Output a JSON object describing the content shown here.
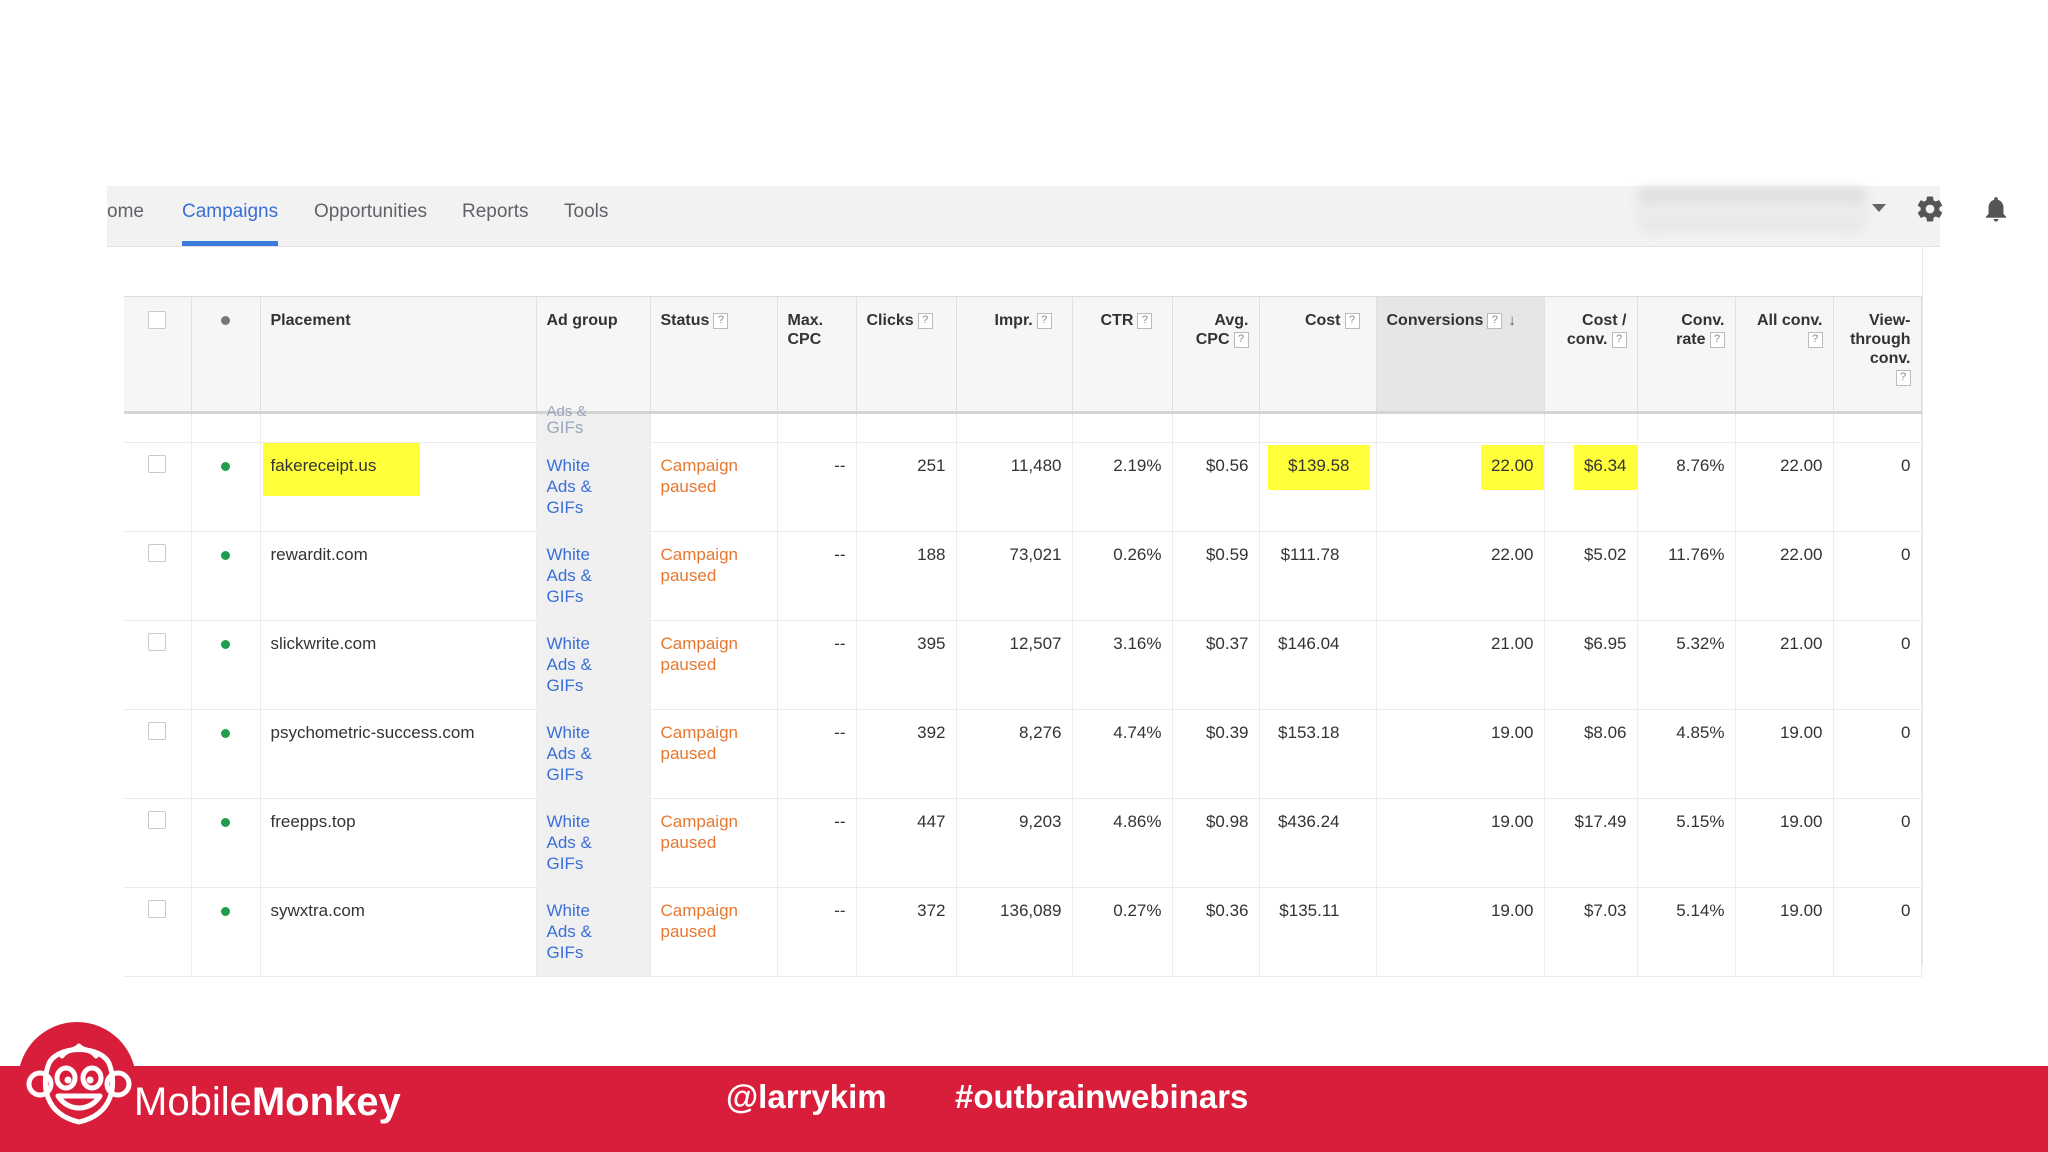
{
  "nav": {
    "tabs": [
      {
        "label": "ome",
        "active": false
      },
      {
        "label": "Campaigns",
        "active": true
      },
      {
        "label": "Opportunities",
        "active": false
      },
      {
        "label": "Reports",
        "active": false
      },
      {
        "label": "Tools",
        "active": false
      }
    ],
    "icons": [
      "caret-down-icon",
      "gear-icon",
      "bell-icon"
    ]
  },
  "table": {
    "headers": {
      "placement": "Placement",
      "ad_group": "Ad group",
      "status": "Status",
      "max_cpc_1": "Max.",
      "max_cpc_2": "CPC",
      "clicks": "Clicks",
      "impr": "Impr.",
      "ctr": "CTR",
      "avg_cpc_1": "Avg.",
      "avg_cpc_2": "CPC",
      "cost": "Cost",
      "conversions": "Conversions",
      "cost_conv_1": "Cost /",
      "cost_conv_2": "conv.",
      "conv_rate_1": "Conv.",
      "conv_rate_2": "rate",
      "all_conv": "All conv.",
      "view_1": "View-",
      "view_2": "through",
      "view_3": "conv.",
      "help": "?"
    },
    "partial_row": {
      "ad_group_1": "Ads &",
      "ad_group_2": "GIFs"
    },
    "rows": [
      {
        "placement": "fakereceipt.us",
        "ad_group_1": "White",
        "ad_group_2": "Ads &",
        "ad_group_3": "GIFs",
        "status_1": "Campaign",
        "status_2": "paused",
        "max_cpc": "--",
        "clicks": "251",
        "impr": "11,480",
        "ctr": "2.19%",
        "avg_cpc": "$0.56",
        "cost": "$139.58",
        "conversions": "22.00",
        "cost_conv": "$6.34",
        "conv_rate": "8.76%",
        "all_conv": "22.00",
        "view_through": "0"
      },
      {
        "placement": "rewardit.com",
        "ad_group_1": "White",
        "ad_group_2": "Ads &",
        "ad_group_3": "GIFs",
        "status_1": "Campaign",
        "status_2": "paused",
        "max_cpc": "--",
        "clicks": "188",
        "impr": "73,021",
        "ctr": "0.26%",
        "avg_cpc": "$0.59",
        "cost": "$111.78",
        "conversions": "22.00",
        "cost_conv": "$5.02",
        "conv_rate": "11.76%",
        "all_conv": "22.00",
        "view_through": "0"
      },
      {
        "placement": "slickwrite.com",
        "ad_group_1": "White",
        "ad_group_2": "Ads &",
        "ad_group_3": "GIFs",
        "status_1": "Campaign",
        "status_2": "paused",
        "max_cpc": "--",
        "clicks": "395",
        "impr": "12,507",
        "ctr": "3.16%",
        "avg_cpc": "$0.37",
        "cost": "$146.04",
        "conversions": "21.00",
        "cost_conv": "$6.95",
        "conv_rate": "5.32%",
        "all_conv": "21.00",
        "view_through": "0"
      },
      {
        "placement": "psychometric-success.com",
        "ad_group_1": "White",
        "ad_group_2": "Ads &",
        "ad_group_3": "GIFs",
        "status_1": "Campaign",
        "status_2": "paused",
        "max_cpc": "--",
        "clicks": "392",
        "impr": "8,276",
        "ctr": "4.74%",
        "avg_cpc": "$0.39",
        "cost": "$153.18",
        "conversions": "19.00",
        "cost_conv": "$8.06",
        "conv_rate": "4.85%",
        "all_conv": "19.00",
        "view_through": "0"
      },
      {
        "placement": "freepps.top",
        "ad_group_1": "White",
        "ad_group_2": "Ads &",
        "ad_group_3": "GIFs",
        "status_1": "Campaign",
        "status_2": "paused",
        "max_cpc": "--",
        "clicks": "447",
        "impr": "9,203",
        "ctr": "4.86%",
        "avg_cpc": "$0.98",
        "cost": "$436.24",
        "conversions": "19.00",
        "cost_conv": "$17.49",
        "conv_rate": "5.15%",
        "all_conv": "19.00",
        "view_through": "0"
      },
      {
        "placement": "sywxtra.com",
        "ad_group_1": "White",
        "ad_group_2": "Ads &",
        "ad_group_3": "GIFs",
        "status_1": "Campaign",
        "status_2": "paused",
        "max_cpc": "--",
        "clicks": "372",
        "impr": "136,089",
        "ctr": "0.27%",
        "avg_cpc": "$0.36",
        "cost": "$135.11",
        "conversions": "19.00",
        "cost_conv": "$7.03",
        "conv_rate": "5.14%",
        "all_conv": "19.00",
        "view_through": "0"
      }
    ]
  },
  "footer": {
    "brand_part1": "Mobile",
    "brand_part2": "Monkey",
    "handle": "@larrykim",
    "hashtag": "#outbrainwebinars"
  },
  "colors": {
    "accent": "#3a6fd8",
    "status": "#e8772e",
    "highlight": "#ffff3a",
    "footer": "#d91e3c",
    "active_dot": "#1e9e4a"
  }
}
